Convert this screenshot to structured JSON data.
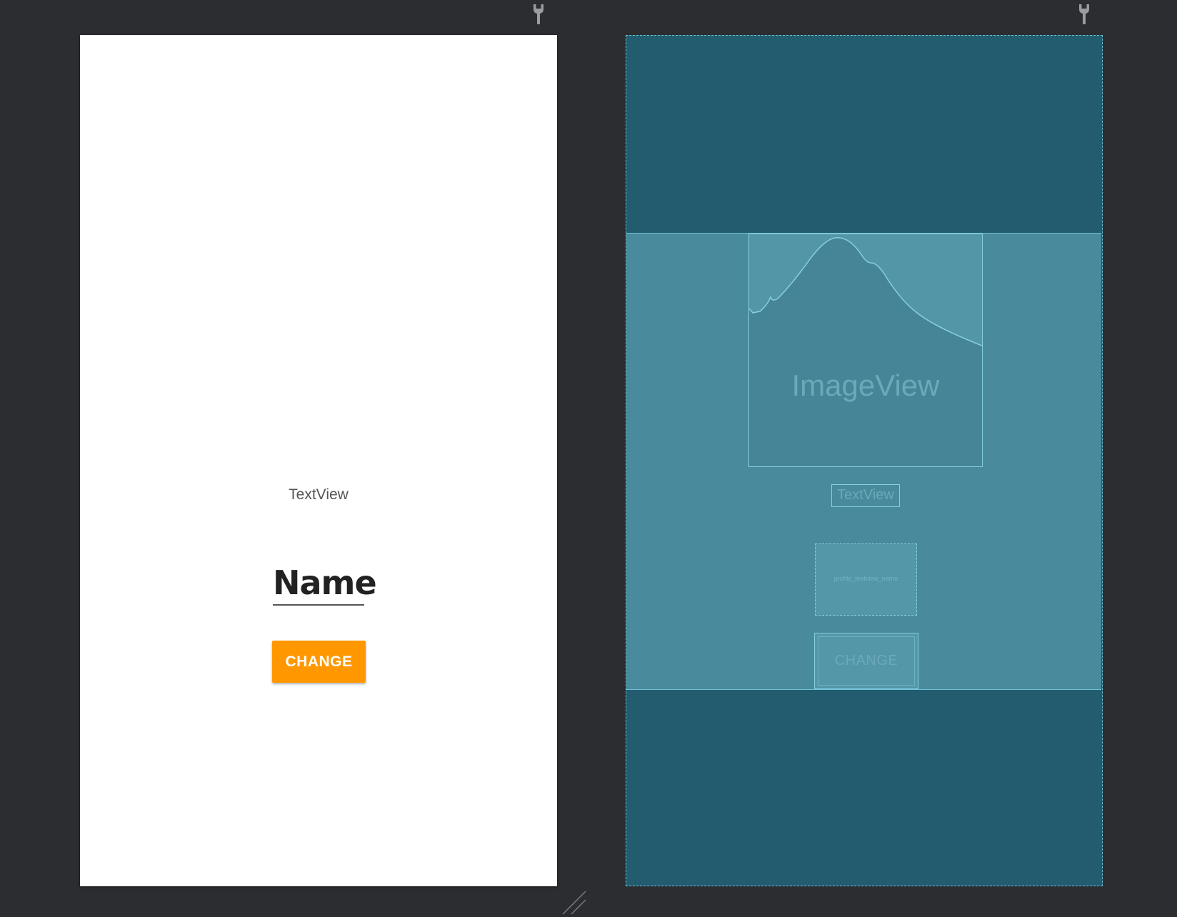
{
  "toolbar": {
    "design_wrench_icon": "wrench-icon",
    "blueprint_wrench_icon": "wrench-icon"
  },
  "design": {
    "textview_text": "TextView",
    "name_text": "Name",
    "change_label": "CHANGE",
    "button_color": "#ff9800"
  },
  "blueprint": {
    "imageview_label": "ImageView",
    "textview_label": "TextView",
    "name_view_id": "profile_textview_name",
    "change_label": "CHANGE",
    "background_color": "#225c6e",
    "region_color": "#498a9c",
    "outline_color": "#6fc1d6"
  },
  "resize_handle": "resize-grip-icon"
}
